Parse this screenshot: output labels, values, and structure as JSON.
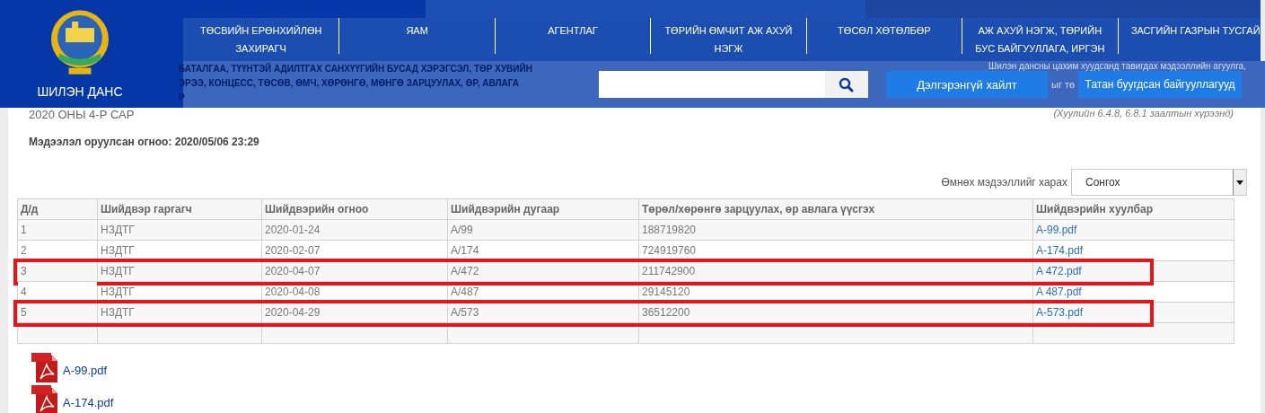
{
  "logo": {
    "label": "ШИЛЭН ДАНС"
  },
  "nav": [
    {
      "label": "ТӨСВИЙН ЕРӨНХИЙЛӨН ЗАХИРАГЧ"
    },
    {
      "label": "ЯАМ"
    },
    {
      "label": "АГЕНТЛАГ"
    },
    {
      "label": "ТӨРИЙН ӨМЧИТ АЖ АХУЙ НЭГЖ"
    },
    {
      "label": "ТӨСӨЛ ХӨТӨЛБӨР"
    },
    {
      "label": "АЖ АХУЙ НЭГЖ, ТӨРИЙН БУС БАЙГУУЛЛАГА, ИРГЭН"
    },
    {
      "label": "ЗАСГИЙН ГАЗРЫН ТУСГАЙ"
    }
  ],
  "title_lines": [
    "БАТАЛГАА, ТҮҮНТЭЙ АДИЛТГАХ САНХҮҮГИЙН БУСАД ХЭРЭГСЭЛ, ТӨР ХУВИЙН",
    "ЭРЭЭ, КОНЦЕСС, ТӨСӨВ, ӨМЧ, ХӨРӨНГӨ, МӨНГӨ ЗАРЦУУЛАХ, ӨР, АВЛАГА",
    "Р"
  ],
  "side_note": {
    "line_1": "Шилэн дансны цахим хуудсанд тавигдах мэдээллийн агуулга,",
    "line_2": "ыг тө",
    "law_ref": "(Хуулийн 6.4.8, 6.8.1 заалтын хүрээнд)"
  },
  "buttons": [
    "Дэлгэрэнгүй хайлт",
    "Татан буугдсан байгууллагууд"
  ],
  "period": "2020 ОНЫ 4-Р САР",
  "uploaded": "Мэдээлэл оруулсан огноо: 2020/05/06 23:29",
  "history": {
    "label": "Өмнөх мэдээллийг харах",
    "value": "Сонгох"
  },
  "table": {
    "columns": [
      "Д/д",
      "Шийдвэр гаргагч",
      "Шийдвэрийн огноо",
      "Шийдвэрийн дугаар",
      "Төрөл/хөрөнгө зарцуулах, өр авлага үүсгэх",
      "Шийдвэрийн хуулбар"
    ],
    "rows": [
      {
        "cells": [
          "1",
          "НЗДТГ",
          "2020-01-24",
          "А/99",
          "188719820"
        ],
        "file": "A-99.pdf",
        "highlighted": false
      },
      {
        "cells": [
          "2",
          "НЗДТГ",
          "2020-02-07",
          "А/174",
          "724919760"
        ],
        "file": "A-174.pdf",
        "highlighted": false
      },
      {
        "cells": [
          "3",
          "НЗДТГ",
          "2020-04-07",
          "А/472",
          "211742900"
        ],
        "file": "A 472.pdf",
        "highlighted": true
      },
      {
        "cells": [
          "4",
          "НЗДТГ",
          "2020-04-08",
          "А/487",
          "29145120"
        ],
        "file": "A 487.pdf",
        "highlighted": false
      },
      {
        "cells": [
          "5",
          "НЗДТГ",
          "2020-04-29",
          "А/573",
          "36512200"
        ],
        "file": "A-573.pdf",
        "highlighted": true
      }
    ]
  },
  "attachments": [
    "A-99.pdf",
    "A-174.pdf"
  ]
}
